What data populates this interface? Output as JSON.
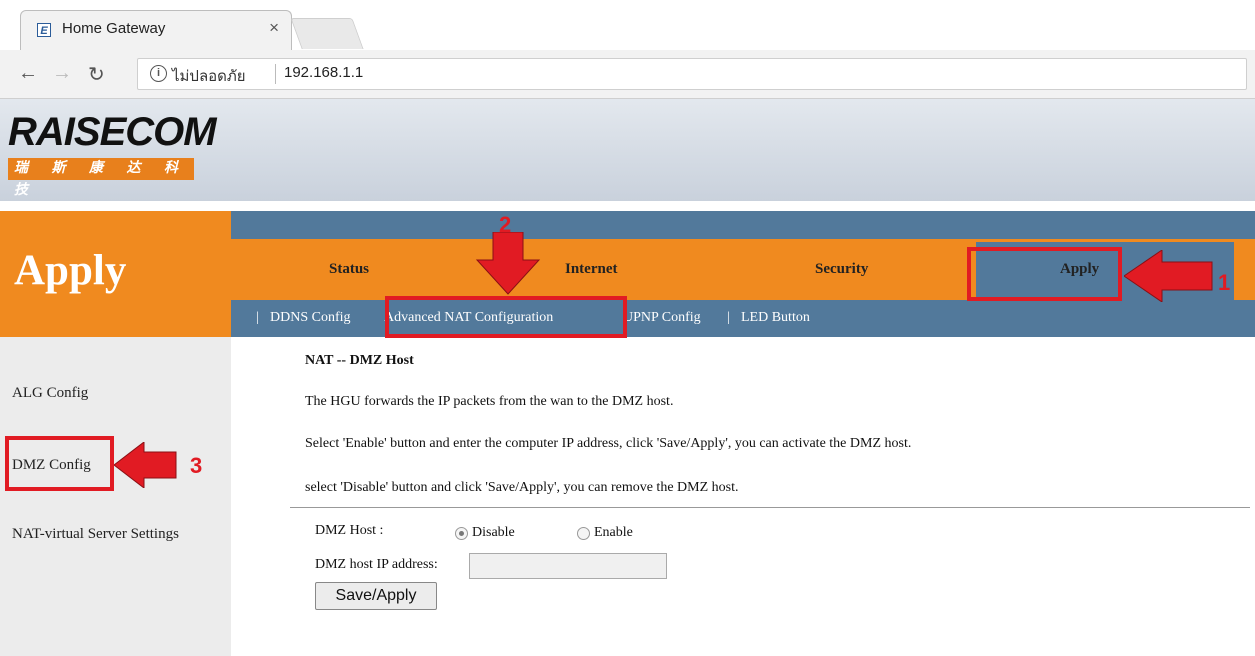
{
  "browser": {
    "tab_title": "Home Gateway",
    "tab_favicon": "E",
    "close_glyph": "×",
    "security_text": "ไม่ปลอดภัย",
    "url": "192.168.1.1"
  },
  "header": {
    "logo_text": "RAISECOM",
    "logo_sub": "瑞 斯 康 达 科 技"
  },
  "section_title": "Apply",
  "main_nav": [
    {
      "label": "Status"
    },
    {
      "label": "Internet"
    },
    {
      "label": "Security"
    },
    {
      "label": "Apply"
    }
  ],
  "sub_nav": {
    "separator": "|",
    "items": [
      "DDNS Config",
      "Advanced NAT Configuration",
      "UPNP Config",
      "LED Button"
    ]
  },
  "sidebar": {
    "items": [
      "ALG Config",
      "DMZ Config",
      "NAT-virtual Server Settings"
    ]
  },
  "content": {
    "title": "NAT -- DMZ Host",
    "para1": "The HGU forwards the IP packets from the wan to the DMZ host.",
    "para2": "Select 'Enable' button and enter the computer IP address, click 'Save/Apply', you can activate the DMZ host.",
    "para3": "select 'Disable' button and click 'Save/Apply', you can remove the DMZ host.",
    "dmz_host_label": "DMZ Host :",
    "radio_disable": "Disable",
    "radio_enable": "Enable",
    "selected": "Disable",
    "ip_label": "DMZ host IP address:",
    "ip_value": "",
    "save_label": "Save/Apply"
  },
  "annotations": {
    "step1": "1",
    "step2": "2",
    "step3": "3",
    "color": "#e11b23"
  },
  "colors": {
    "orange": "#f08a1f",
    "steel_blue": "#52799b"
  }
}
